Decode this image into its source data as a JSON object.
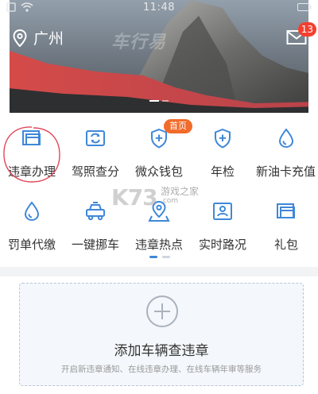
{
  "status_bar": {
    "time": "11:48"
  },
  "header": {
    "city": "广州",
    "watermark": "车行易",
    "mail_badge": "13",
    "banner_dot_count": 2
  },
  "grid": {
    "rows": [
      [
        {
          "label": "违章办理",
          "icon": "violation-card-icon"
        },
        {
          "label": "驾照查分",
          "icon": "license-refresh-icon"
        },
        {
          "label": "微众钱包",
          "icon": "shield-plus-icon"
        },
        {
          "label": "年检",
          "icon": "shield-plus-icon"
        },
        {
          "label": "新油卡充值",
          "icon": "drop-icon"
        }
      ],
      [
        {
          "label": "罚单代缴",
          "icon": "drop-icon"
        },
        {
          "label": "一键挪车",
          "icon": "car-icon"
        },
        {
          "label": "违章热点",
          "icon": "map-pin-icon"
        },
        {
          "label": "实时路况",
          "icon": "contact-card-icon"
        },
        {
          "label": "礼包",
          "icon": "card-icon"
        }
      ]
    ],
    "home_badge": "首页"
  },
  "watermark_site": {
    "mark": "K73",
    "cn": "游戏之家",
    "en": ".com"
  },
  "add_vehicle": {
    "title": "添加车辆查违章",
    "subtitle": "开启新违章通知、在线违章办理、在线车辆年审等服务"
  },
  "colors": {
    "accent": "#3f88d8",
    "badge_red": "#f43f2e",
    "badge_orange": "#f26b2a"
  }
}
